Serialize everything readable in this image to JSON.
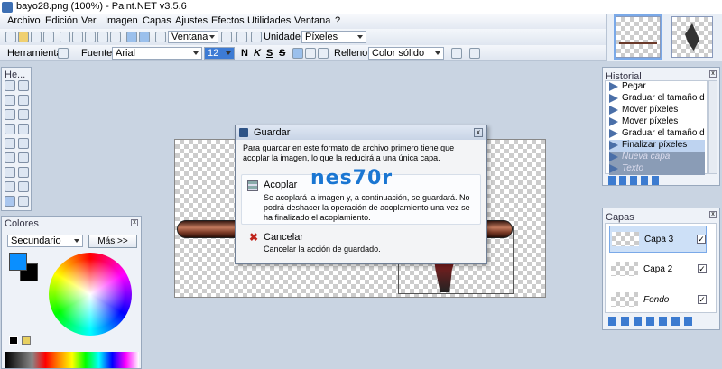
{
  "window": {
    "title": "bayo28.png (100%) - Paint.NET v3.5.6"
  },
  "menu": [
    "Archivo",
    "Edición",
    "Ver",
    "Imagen",
    "Capas",
    "Ajustes",
    "Efectos",
    "Utilidades",
    "Ventana",
    "?"
  ],
  "toolbar": {
    "zoom_select": "Ventana",
    "units_label": "Unidades:",
    "units_value": "Píxeles",
    "tool_label": "Herramienta:",
    "font_label": "Fuente:",
    "font_value": "Arial",
    "size_value": "12",
    "bold": "N",
    "italic": "K",
    "underline": "S",
    "strike": "S",
    "fill_label": "Relleno:",
    "fill_value": "Color sólido"
  },
  "tools_panel": {
    "title": "He..."
  },
  "history": {
    "title": "Historial",
    "items": [
      "Pegar",
      "Graduar el tamaño de ...",
      "Mover píxeles",
      "Mover píxeles",
      "Graduar el tamaño de ...",
      "Finalizar píxeles",
      "Nueva capa",
      "Texto"
    ]
  },
  "layers": {
    "title": "Capas",
    "items": [
      {
        "name": "Capa 3",
        "checked": "✓"
      },
      {
        "name": "Capa 2",
        "checked": "✓"
      },
      {
        "name": "Fondo",
        "checked": "✓"
      }
    ]
  },
  "colors": {
    "title": "Colores",
    "mode": "Secundario",
    "more_button": "Más >>",
    "primary": "#0a8fff",
    "secondary": "#000000"
  },
  "dialog": {
    "title": "Guardar",
    "message": "Para guardar en este formato de archivo primero tiene que acoplar la imagen, lo que la reducirá a una única capa.",
    "option1_title": "Acoplar",
    "option1_desc": "Se acoplará la imagen y, a continuación, se guardará. No podrá deshacer la operación de acoplamiento una vez se ha finalizado el acoplamiento.",
    "option2_title": "Cancelar",
    "option2_desc": "Cancelar la acción de guardado."
  },
  "watermark": "nes70r"
}
